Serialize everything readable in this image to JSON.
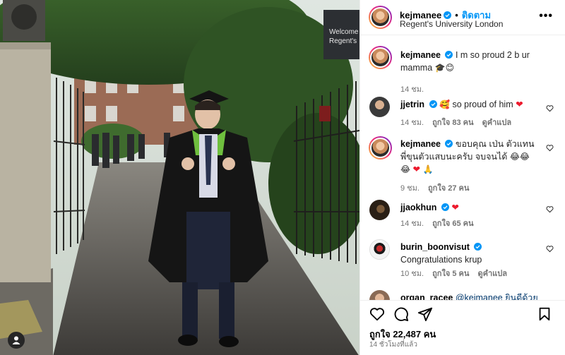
{
  "post": {
    "username": "kejmanee",
    "follow_label": "ติดตาม",
    "location": "Regent's University London",
    "more_label": "•••",
    "likes_text": "ถูกใจ 22,487 คน",
    "time_ago": "14 ชั่วโมงที่แล้ว",
    "photo_sign_text": [
      "Welcome",
      "Regent's"
    ]
  },
  "caption": {
    "username": "kejmanee",
    "text": "I m so proud 2 b ur mamma",
    "emoji": "🎓😊",
    "time": "14 ชม."
  },
  "comments": [
    {
      "username": "jjetrin",
      "text": "",
      "emoji": "🥰",
      "text2": " so proud of him ",
      "heart": "❤",
      "time": "14 ชม.",
      "likes": "ถูกใจ 83 คน",
      "translate": "ดูคำแปล"
    },
    {
      "username": "kejmanee",
      "text": "ขอบคุณ เป่น ตัวแทนพี่ขุนตัวแสบนะครับ จบจนได้ ",
      "emoji": "😂😂😂",
      "heart": "❤",
      "emoji2": "🙏",
      "time": "9 ชม.",
      "likes": "ถูกใจ 27 คน"
    },
    {
      "username": "jjaokhun",
      "heart": "❤",
      "time": "14 ชม.",
      "likes": "ถูกใจ 65 คน"
    },
    {
      "username": "burin_boonvisut",
      "text": "Congratulations krup",
      "time": "10 ชม.",
      "likes": "ถูกใจ 5 คน",
      "translate": "ดูคำแปล"
    },
    {
      "username": "organ_racee",
      "text": "@kejmanee ยินดีด้วย"
    }
  ],
  "icons": [
    "person-tag-icon",
    "more-options-icon",
    "verified-icon",
    "heart-icon",
    "comment-icon",
    "share-icon",
    "bookmark-icon"
  ],
  "colors": {
    "link": "#0095f6",
    "verified": "#0095f6",
    "heart": "#ed1b2e",
    "muted": "#737373"
  }
}
